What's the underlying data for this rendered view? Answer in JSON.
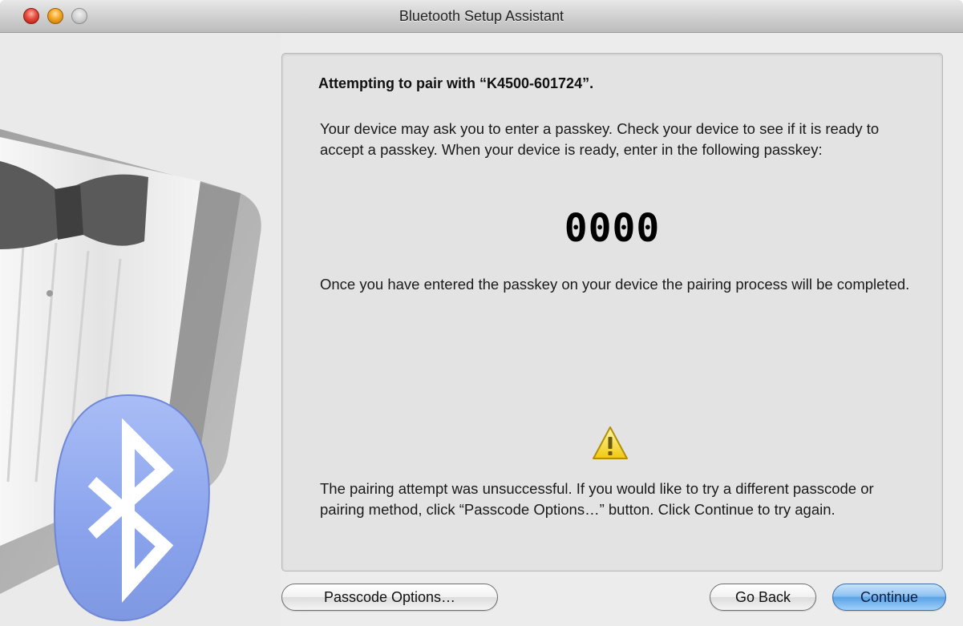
{
  "window": {
    "title": "Bluetooth Setup Assistant"
  },
  "panel": {
    "heading": "Attempting to pair with “K4500-601724”.",
    "instructions": "Your device may ask you to enter a passkey. Check your device to see if it is ready to accept a passkey. When your device is ready, enter in the following passkey:",
    "passkey": "0000",
    "completion_note": "Once you have entered the passkey on your device the pairing process will be completed.",
    "warning_icon": "warning-triangle-icon",
    "error_message": "The pairing attempt was unsuccessful. If you would like to try a different passcode or pairing method, click “Passcode Options…” button. Click Continue to try again."
  },
  "buttons": {
    "passcode_options": "Passcode Options…",
    "go_back": "Go Back",
    "continue": "Continue"
  },
  "colors": {
    "bluetooth_badge": "#8fa8ee",
    "default_button": "#5ba3e6",
    "warning": "#f4d21e"
  }
}
